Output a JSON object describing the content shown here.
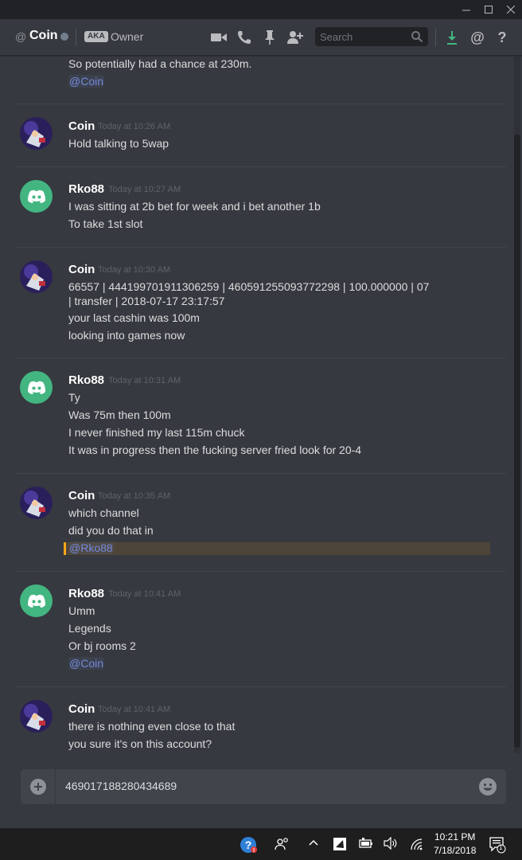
{
  "window": {
    "minimize_label": "–",
    "maximize_label": "☐",
    "close_label": "✕"
  },
  "header": {
    "at_symbol": "@",
    "channel_name": "Coin",
    "aka_badge": "AKA",
    "aka_value": "Owner",
    "search_placeholder": "Search"
  },
  "messages": [
    {
      "continuation": true,
      "lines": [
        "So potentially had a chance at 230m.",
        "@Coin"
      ]
    },
    {
      "author": "Coin",
      "timestamp": "Today at 10:26 AM",
      "lines": [
        "Hold talking to 5wap"
      ]
    },
    {
      "author": "Rko88",
      "timestamp": "Today at 10:27 AM",
      "lines": [
        "I was sitting at 2b bet for week and i bet another 1b",
        "To take 1st slot"
      ]
    },
    {
      "author": "Coin",
      "timestamp": "Today at 10:30 AM",
      "lines": [
        "66557 | 444199701911306259 | 460591255093772298 | 100.000000 | 07",
        "| transfer | 2018-07-17 23:17:57",
        "your last cashin was 100m",
        "looking into games now"
      ]
    },
    {
      "author": "Rko88",
      "timestamp": "Today at 10:31 AM",
      "lines": [
        "Ty",
        "Was 75m then 100m",
        "I never finished my last 115m chuck",
        "It was in progress then the fucking server fried look for 20-4"
      ]
    },
    {
      "author": "Coin",
      "timestamp": "Today at 10:35 AM",
      "lines": [
        "which channel",
        "did you do that in",
        "@Rko88"
      ]
    },
    {
      "author": "Rko88",
      "timestamp": "Today at 10:41 AM",
      "lines": [
        "Umm",
        "Legends",
        "Or bj rooms 2",
        "@Coin"
      ]
    },
    {
      "author": "Coin",
      "timestamp": "Today at 10:41 AM",
      "lines": [
        "there is nothing even close to that",
        "you sure it's on this account?"
      ]
    }
  ],
  "composer": {
    "value": "469017188280434689"
  },
  "taskbar": {
    "time": "10:21 PM",
    "date": "7/18/2018",
    "notification_count": "1"
  },
  "colors": {
    "background": "#36393f",
    "accent": "#7289da",
    "discord_green": "#43b581",
    "mention_highlight": "#faa61a"
  }
}
